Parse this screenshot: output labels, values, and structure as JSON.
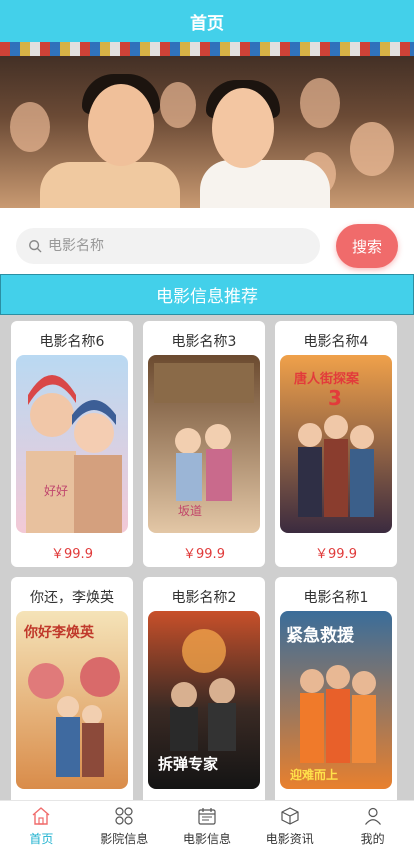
{
  "header": {
    "title": "首页"
  },
  "search": {
    "placeholder": "电影名称",
    "button_label": "搜索"
  },
  "section": {
    "title": "电影信息推荐"
  },
  "movies": [
    {
      "name": "电影名称6",
      "price": "￥99.9"
    },
    {
      "name": "电影名称3",
      "price": "￥99.9"
    },
    {
      "name": "电影名称4",
      "price": "￥99.9"
    },
    {
      "name": "你还，李焕英",
      "price": ""
    },
    {
      "name": "电影名称2",
      "price": ""
    },
    {
      "name": "电影名称1",
      "price": ""
    }
  ],
  "tabs": [
    {
      "label": "首页",
      "icon": "home-icon"
    },
    {
      "label": "影院信息",
      "icon": "grid-icon"
    },
    {
      "label": "电影信息",
      "icon": "calendar-icon"
    },
    {
      "label": "电影资讯",
      "icon": "box-icon"
    },
    {
      "label": "我的",
      "icon": "user-icon"
    }
  ],
  "colors": {
    "accent": "#43d0ea",
    "search_button": "#f06b6b",
    "price": "#e03a3a",
    "active_tab": "#1fb2cf"
  }
}
